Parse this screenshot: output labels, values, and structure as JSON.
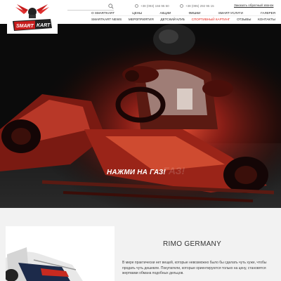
{
  "header": {
    "search_placeholder": "",
    "phones": [
      "+38 (093) 156 95 50",
      "+38 (095) 292 95 15"
    ],
    "callback_link": "Заказать обратный звонок",
    "logo_text": "SMART KART"
  },
  "nav": {
    "row1": [
      "О SMARTKART",
      "ЦЕНЫ",
      "АКЦИИ",
      "ФИШКИ",
      "SMART-УСЛУГИ",
      "ГАЛЕРЕЯ"
    ],
    "row2": [
      "SMARTKART NEWS",
      "МЕРОПРИЯТИЯ",
      "ДЕТСКИЙ КЛУБ",
      "СПОРТИВНЫЙ КАРТИНГ",
      "ОТЗЫВЫ",
      "КОНТАКТЫ"
    ],
    "active": "СПОРТИВНЫЙ КАРТИНГ"
  },
  "hero": {
    "title": "НАЖМИ НА ГАЗ!"
  },
  "section": {
    "title": "RIMO GERMANY",
    "text": "В мире практически нет вещей, которые невозможно было бы сделать чуть хуже, чтобы продать чуть дешевле. Покупатели, которые ориентируются только на цену, становятся жертвами обмана подобных дельцов."
  },
  "colors": {
    "accent": "#e1251b",
    "hero_bg": "#0b0b0b",
    "section_bg": "#f2f2f2"
  }
}
